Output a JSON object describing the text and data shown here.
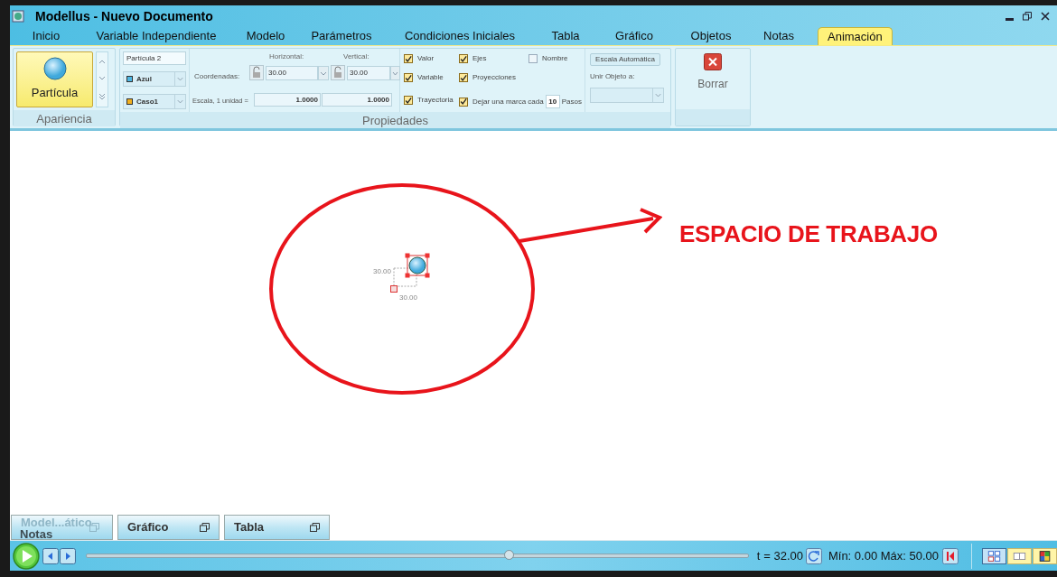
{
  "window": {
    "title": "Modellus - Nuevo Documento"
  },
  "tabs": [
    {
      "label": "Inicio",
      "selected": false
    },
    {
      "label": "Variable Independiente",
      "selected": false
    },
    {
      "label": "Modelo",
      "selected": false
    },
    {
      "label": "Parámetros",
      "selected": false
    },
    {
      "label": "Condiciones Iniciales",
      "selected": false
    },
    {
      "label": "Tabla",
      "selected": false
    },
    {
      "label": "Gráfico",
      "selected": false
    },
    {
      "label": "Objetos",
      "selected": false
    },
    {
      "label": "Notas",
      "selected": false
    },
    {
      "label": "Animación",
      "selected": true
    }
  ],
  "ribbon": {
    "apariencia": {
      "label": "Apariencia",
      "button": "Partícula"
    },
    "propiedades": {
      "label": "Propiedades",
      "name_value": "Partícula 2",
      "dropdowns": [
        {
          "value": "Azul",
          "color": "#4db6e2"
        },
        {
          "value": "Caso1",
          "color": "#f2b01e"
        }
      ],
      "coordinates_label": "Coordenadas:",
      "horizontal_label": "Horizontal:",
      "vertical_label": "Vertical:",
      "horizontal_value": "30.00",
      "vertical_value": "30.00",
      "scale_label": "Escala, 1 unidad =",
      "scale_horizontal": "1.0000",
      "scale_vertical": "1.0000",
      "checkbox_rows": [
        [
          {
            "label": "Valor",
            "checked": true
          },
          {
            "label": "Ejes",
            "checked": true
          },
          {
            "label": "Nombre",
            "checked": false
          }
        ],
        [
          {
            "label": "Variable",
            "checked": true
          },
          {
            "label": "Proyecciones",
            "checked": true
          }
        ],
        [
          {
            "label": "Trayectoria",
            "checked": true
          },
          {
            "label": "Dejar una marca cada",
            "checked": true
          }
        ]
      ],
      "marks_value": "10",
      "marks_unit": "Pasos",
      "auto_scale_button": "Escala Automática",
      "attach_label": "Unir Objeto a:"
    },
    "delete_button": "Borrar"
  },
  "workspace": {
    "particle": {
      "y_label": "30.00",
      "x_label": "30.00"
    },
    "annotation": "ESPACIO DE TRABAJO"
  },
  "docked_tabs": [
    {
      "label": "Model...ático"
    },
    {
      "label": "Gráfico"
    },
    {
      "label": "Tabla"
    }
  ],
  "notas_label": "Notas",
  "player": {
    "level": 0.64,
    "t_label": "t",
    "t_value": "= 32.00",
    "range": "Mín: 0.00 Máx: 50.00"
  },
  "view_buttons": [
    {
      "selected": true
    },
    {
      "selected": false
    },
    {
      "selected": false
    }
  ]
}
